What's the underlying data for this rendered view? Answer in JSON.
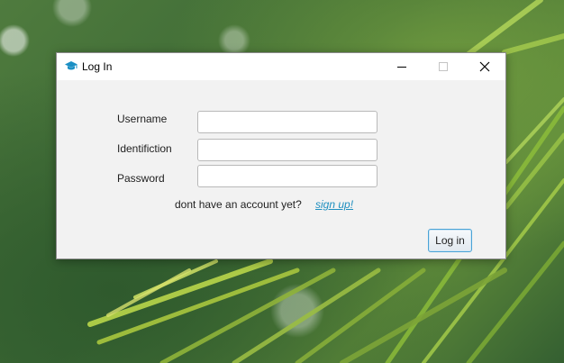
{
  "window": {
    "title": "Log In",
    "controls": {
      "minimize": "minimize-icon",
      "maximize": "maximize-icon",
      "close": "close-icon"
    }
  },
  "form": {
    "username_label": "Username",
    "username_value": "",
    "identification_label": "Identifiction",
    "identification_value": "",
    "password_label": "Password",
    "password_value": ""
  },
  "signup": {
    "prompt": "dont have an account yet?",
    "link_label": "sign up!"
  },
  "actions": {
    "login_label": "Log in"
  },
  "colors": {
    "link": "#1f8fbf",
    "button_border": "#4aa3d6",
    "app_icon": "#1b8fc4"
  }
}
